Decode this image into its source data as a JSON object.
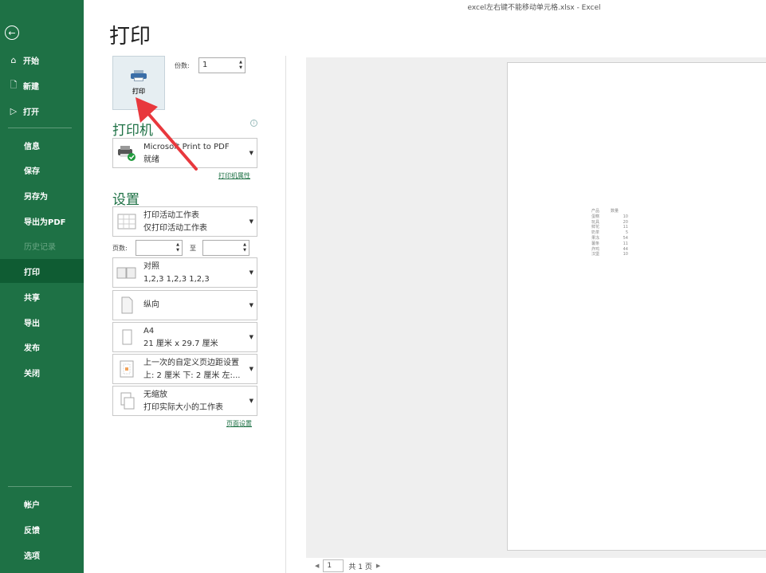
{
  "window_title": "excel左右键不能移动单元格.xlsx  -  Excel",
  "sidebar": {
    "back_icon": "back-arrow-icon",
    "top_items": [
      {
        "label": "开始",
        "icon": "home-icon"
      },
      {
        "label": "新建",
        "icon": "new-file-icon"
      },
      {
        "label": "打开",
        "icon": "open-folder-icon"
      }
    ],
    "mid_items": [
      {
        "label": "信息"
      },
      {
        "label": "保存"
      },
      {
        "label": "另存为"
      },
      {
        "label": "导出为PDF"
      },
      {
        "label": "历史记录",
        "disabled": true
      },
      {
        "label": "打印",
        "active": true
      },
      {
        "label": "共享"
      },
      {
        "label": "导出"
      },
      {
        "label": "发布"
      },
      {
        "label": "关闭"
      }
    ],
    "bottom_items": [
      {
        "label": "帐户"
      },
      {
        "label": "反馈"
      },
      {
        "label": "选项"
      }
    ],
    "bg_color": "#1e7145"
  },
  "main": {
    "title": "打印",
    "print_button_label": "打印",
    "copies_label": "份数:",
    "copies_value": "1",
    "printer_section_title": "打印机",
    "printer": {
      "name": "Microsoft Print to PDF",
      "status": "就绪"
    },
    "printer_properties_link": "打印机属性",
    "settings_section_title": "设置",
    "settings": [
      {
        "line1": "打印活动工作表",
        "line2": "仅打印活动工作表"
      },
      {
        "line1": "对照",
        "line2": "1,2,3    1,2,3    1,2,3"
      },
      {
        "line1": "纵向",
        "line2": ""
      },
      {
        "line1": "A4",
        "line2": "21 厘米 x 29.7 厘米"
      },
      {
        "line1": "上一次的自定义页边距设置",
        "line2": "上: 2 厘米 下: 2 厘米 左:..."
      },
      {
        "line1": "无缩放",
        "line2": "打印实际大小的工作表"
      }
    ],
    "pages_label": "页数:",
    "pages_to_label": "至",
    "page_setup_link": "页面设置"
  },
  "preview": {
    "table": {
      "headers": [
        "产品",
        "数量"
      ],
      "rows": [
        [
          "蛋糕",
          "10"
        ],
        [
          "玩具",
          "20"
        ],
        [
          "鲜花",
          "11"
        ],
        [
          "奶茶",
          "5"
        ],
        [
          "果冻",
          "54"
        ],
        [
          "薯条",
          "11"
        ],
        [
          "炸鸡",
          "44"
        ],
        [
          "汉堡",
          "10"
        ]
      ]
    },
    "pager": {
      "current_page": "1",
      "total_label": "共 1 页"
    }
  },
  "annotation_color": "#e8383d"
}
